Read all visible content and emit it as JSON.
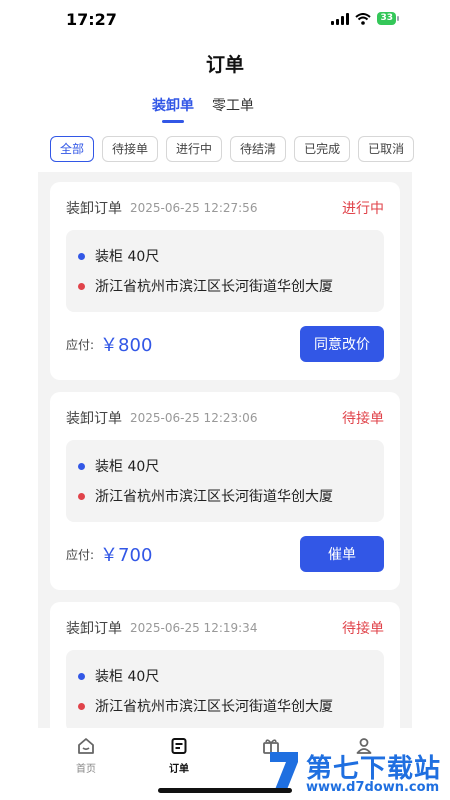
{
  "status_bar": {
    "time": "17:27",
    "battery": "33"
  },
  "header": {
    "title": "订单"
  },
  "order_type_tabs": [
    {
      "label": "装卸单",
      "active": true
    },
    {
      "label": "零工单",
      "active": false
    }
  ],
  "filters": [
    {
      "label": "全部",
      "active": true
    },
    {
      "label": "待接单",
      "active": false
    },
    {
      "label": "进行中",
      "active": false
    },
    {
      "label": "待结清",
      "active": false
    },
    {
      "label": "已完成",
      "active": false
    },
    {
      "label": "已取消",
      "active": false
    }
  ],
  "orders": [
    {
      "type": "装卸订单",
      "time": "2025-06-25 12:27:56",
      "status": "进行中",
      "cargo": "装柜 40尺",
      "address": "浙江省杭州市滨江区长河街道华创大厦",
      "pay_label": "应付:",
      "amount": "￥800",
      "action": "同意改价"
    },
    {
      "type": "装卸订单",
      "time": "2025-06-25 12:23:06",
      "status": "待接单",
      "cargo": "装柜 40尺",
      "address": "浙江省杭州市滨江区长河街道华创大厦",
      "pay_label": "应付:",
      "amount": "￥700",
      "action": "催单"
    },
    {
      "type": "装卸订单",
      "time": "2025-06-25 12:19:34",
      "status": "待接单",
      "cargo": "装柜 40尺",
      "address": "浙江省杭州市滨江区长河街道华创大厦"
    }
  ],
  "bottom_nav": [
    {
      "label": "首页",
      "icon": "home-icon",
      "active": false
    },
    {
      "label": "订单",
      "icon": "orders-icon",
      "active": true
    },
    {
      "label": "",
      "icon": "gift-icon",
      "active": false
    },
    {
      "label": "",
      "icon": "profile-icon",
      "active": false
    }
  ],
  "watermark": {
    "title": "第七下载站",
    "url": "www.d7down.com"
  },
  "colors": {
    "accent": "#3257e6",
    "status_red": "#e0434a",
    "list_bg": "#f3f3f3"
  }
}
